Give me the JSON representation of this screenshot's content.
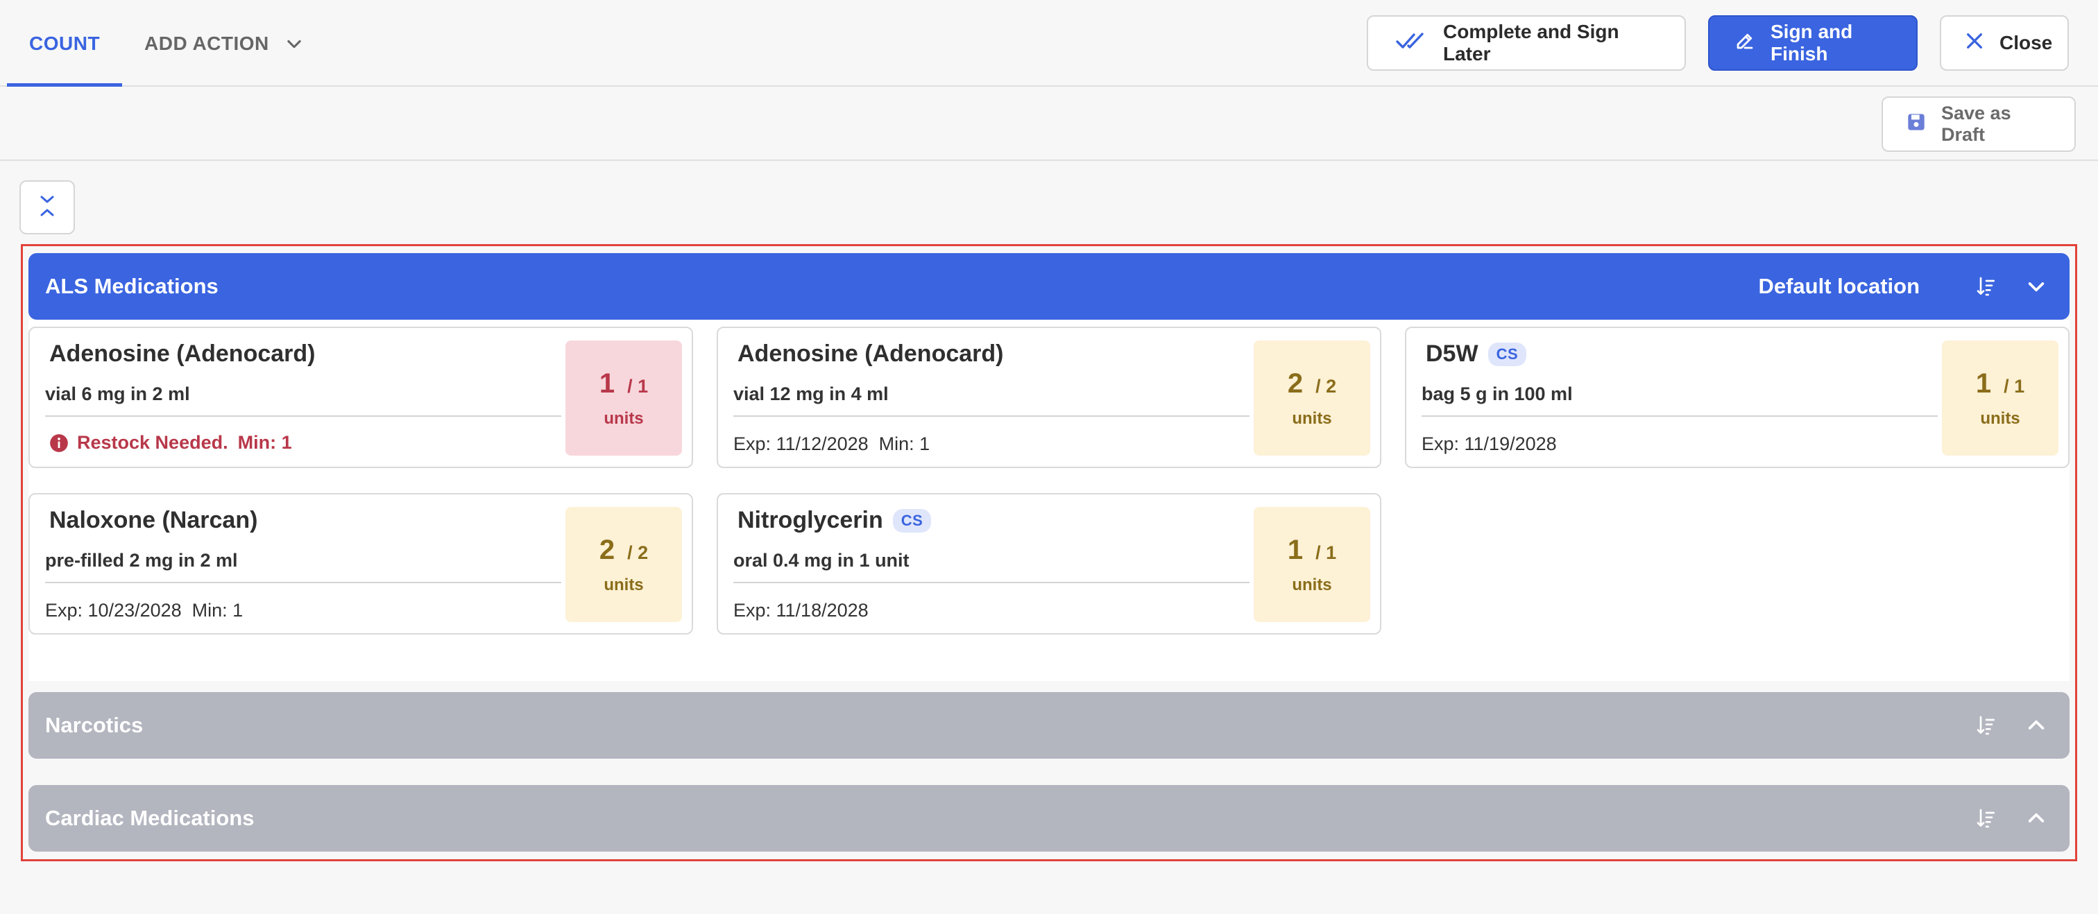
{
  "tabs": {
    "count": "COUNT",
    "add_action": "ADD ACTION"
  },
  "header": {
    "complete_later": "Complete and Sign Later",
    "sign_finish": "Sign and Finish",
    "close": "Close"
  },
  "subbar": {
    "save_draft": "Save as Draft"
  },
  "sections": {
    "als": {
      "title": "ALS Medications",
      "location": "Default location"
    },
    "narcotics": {
      "title": "Narcotics"
    },
    "cardiac": {
      "title": "Cardiac Medications"
    }
  },
  "cards": [
    {
      "name": "Adenosine (Adenocard)",
      "cs": "",
      "desc": "vial 6 mg in 2 ml",
      "meta": "",
      "warning": "Restock Needed.",
      "warning_min": "Min: 1",
      "count": "1",
      "total": "/ 1",
      "unit": "units"
    },
    {
      "name": "Adenosine (Adenocard)",
      "cs": "",
      "desc": "vial 12 mg in 4 ml",
      "meta": "Exp: 11/12/2028  Min: 1",
      "count": "2",
      "total": "/ 2",
      "unit": "units"
    },
    {
      "name": "D5W",
      "cs": "CS",
      "desc": "bag 5 g in 100 ml",
      "meta": "Exp: 11/19/2028",
      "count": "1",
      "total": "/ 1",
      "unit": "units"
    },
    {
      "name": "Naloxone (Narcan)",
      "cs": "",
      "desc": "pre-filled 2 mg in 2 ml",
      "meta": "Exp: 10/23/2028  Min: 1",
      "count": "2",
      "total": "/ 2",
      "unit": "units"
    },
    {
      "name": "Nitroglycerin",
      "cs": "CS",
      "desc": "oral 0.4 mg in 1 unit",
      "meta": "Exp: 11/18/2028",
      "count": "1",
      "total": "/ 1",
      "unit": "units"
    }
  ],
  "colors": {
    "primary": "#3a64e0",
    "section_collapsed": "#b3b5bf",
    "alert_bg": "#f7d7dc",
    "alert_text": "#b8384a",
    "qty_bg": "#fdf1d6",
    "qty_text": "#8a6d1a",
    "highlight_border": "#e0433a"
  },
  "icons": {
    "add_action_toggle": "chevron-down-icon",
    "complete_later": "double-check-icon",
    "sign_finish": "pen-icon",
    "close": "close-icon",
    "save_draft": "floppy-disk-icon",
    "collapse_all": "collapse-chevrons-icon",
    "sort": "sort-descending-icon",
    "als_toggle": "chevron-down-icon",
    "narcotics_toggle": "chevron-up-icon",
    "cardiac_toggle": "chevron-up-icon",
    "warning": "info-circle-icon"
  }
}
